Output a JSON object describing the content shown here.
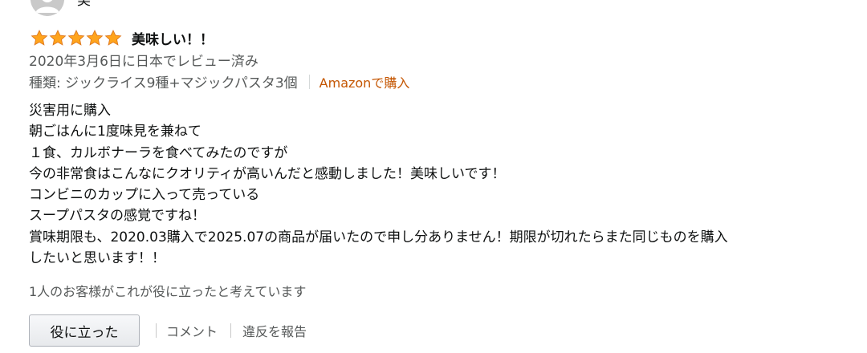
{
  "reviewer": {
    "name": "美"
  },
  "review": {
    "rating": 5,
    "rating_max": 5,
    "title": "美味しい！！",
    "date": "2020年3月6日に日本でレビュー済み",
    "variant": "種類: ジックライス9種+マジックパスタ3個",
    "verified": "Amazonで購入",
    "body_lines": [
      "災害用に購入",
      "朝ごはんに1度味見を兼ねて",
      "１食、カルボナーラを食べてみたのですが",
      "今の非常食はこんなにクオリティが高いんだと感動しました！美味しいです！",
      "コンビニのカップに入って売っている",
      "スープパスタの感覚ですね！",
      "賞味期限も、2020.03購入で2025.07の商品が届いたので申し分ありません！期限が切れたらまた同じものを購入",
      "したいと思います！！"
    ],
    "helpful_count_text": "1人のお客様がこれが役に立ったと考えています"
  },
  "actions": {
    "helpful_label": "役に立った",
    "comment_label": "コメント",
    "report_label": "違反を報告"
  },
  "colors": {
    "star": "#ffa41c",
    "star_outline": "#de7921",
    "verified": "#c45500",
    "muted": "#565959"
  }
}
